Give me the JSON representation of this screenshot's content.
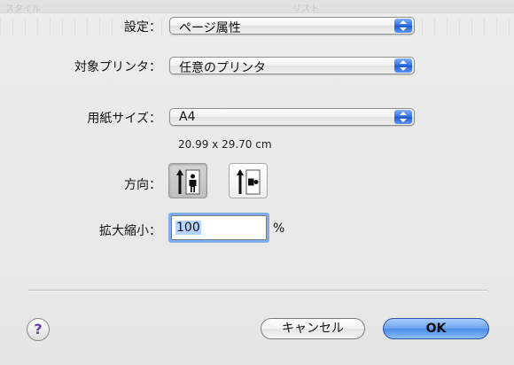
{
  "background_toolbar": {
    "left_text": "スタイル",
    "right_text": "リスト"
  },
  "settings": {
    "label": "設定：",
    "value": "ページ属性"
  },
  "target_printer": {
    "label": "対象プリンタ：",
    "value": "任意のプリンタ"
  },
  "paper_size": {
    "label": "用紙サイズ：",
    "value": "A4",
    "dimensions": "20.99 x 29.70 cm"
  },
  "orientation": {
    "label": "方向：",
    "options": [
      "portrait",
      "landscape"
    ],
    "selected": "portrait"
  },
  "scale": {
    "label": "拡大縮小：",
    "value": "100",
    "unit": "%"
  },
  "buttons": {
    "help": "?",
    "cancel": "キャンセル",
    "ok": "OK"
  },
  "colors": {
    "accent": "#3a7ee8",
    "selection": "#b5d3ff"
  }
}
